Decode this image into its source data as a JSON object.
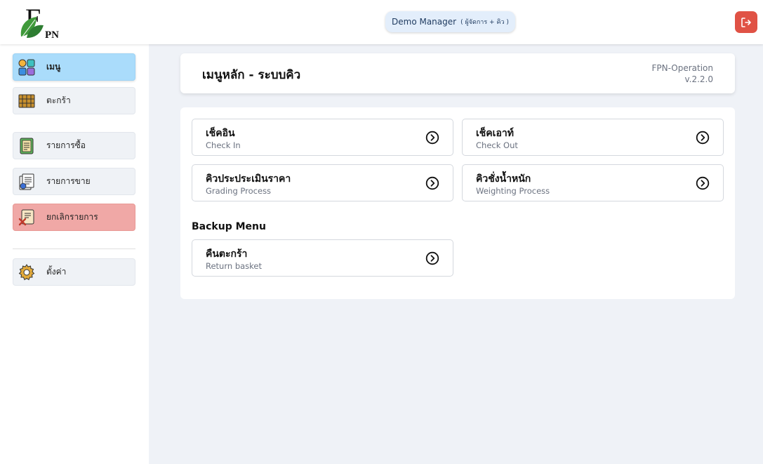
{
  "header": {
    "logo_letters": [
      "F",
      "PN"
    ],
    "user_name": "Demo Manager",
    "user_role": "( ผู้จัดการ + คิว )",
    "logout_icon": "logout-icon"
  },
  "sidebar": {
    "items": [
      {
        "label": "เมนู",
        "icon": "menu-grid-icon",
        "state": "active"
      },
      {
        "label": "ตะกร้า",
        "icon": "basket-icon",
        "state": "normal"
      },
      {
        "label": "รายการซื้อ",
        "icon": "purchase-list-icon",
        "state": "normal"
      },
      {
        "label": "รายการขาย",
        "icon": "sales-list-icon",
        "state": "normal"
      },
      {
        "label": "ยกเลิกรายการ",
        "icon": "cancel-document-icon",
        "state": "danger"
      },
      {
        "label": "ตั้งค่า",
        "icon": "gear-icon",
        "state": "normal"
      }
    ]
  },
  "main": {
    "title": "เมนูหลัก - ระบบคิว",
    "app_name": "FPN-Operation",
    "app_version": "v.2.2.0",
    "menu_cards": [
      {
        "title": "เช็คอิน",
        "subtitle": "Check In"
      },
      {
        "title": "เช็คเอาท์",
        "subtitle": "Check Out"
      },
      {
        "title": "คิวประประเมินราคา",
        "subtitle": "Grading Process"
      },
      {
        "title": "คิวชั่งน้ำหนัก",
        "subtitle": "Weighting Process"
      }
    ],
    "backup_heading": "Backup Menu",
    "backup_cards": [
      {
        "title": "คืนตะกร้า",
        "subtitle": "Return basket"
      }
    ]
  },
  "colors": {
    "active_nav": "#aadcfb",
    "danger_nav": "#f0a8a6",
    "logout_button": "#e05245",
    "page_background": "#eff2f7"
  }
}
